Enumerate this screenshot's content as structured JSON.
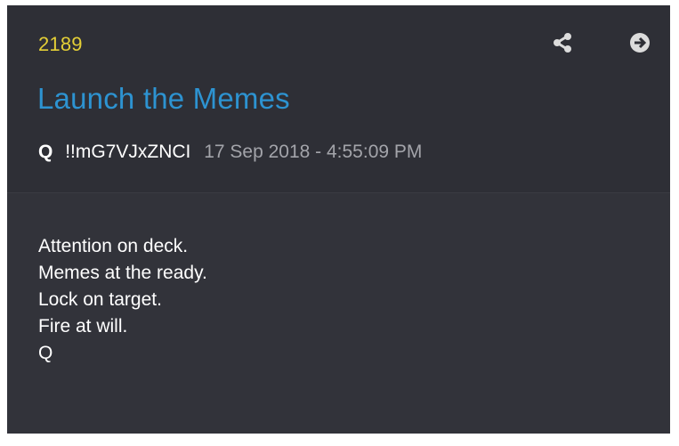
{
  "post": {
    "number": "2189",
    "title": "Launch the Memes",
    "author": "Q",
    "tripcode": "!!mG7VJxZNCI",
    "timestamp": "17 Sep 2018 - 4:55:09 PM",
    "lines": [
      "Attention on deck.",
      "Memes at the ready.",
      "Lock on target.",
      "Fire at will.",
      "Q"
    ]
  },
  "icons": {
    "share": "share-icon",
    "goto": "arrow-circle-right-icon"
  },
  "colors": {
    "card_background": "#32333a",
    "header_background": "#2e2f36",
    "post_number": "#e4cf36",
    "title": "#2d93d1",
    "timestamp": "#a3a4aa",
    "text": "#ffffff"
  }
}
